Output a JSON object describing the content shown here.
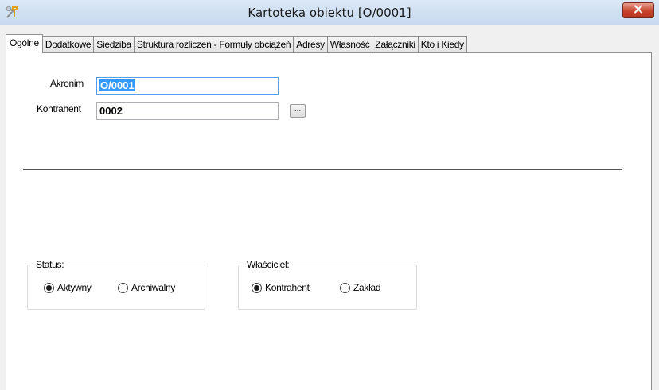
{
  "window": {
    "title": "Kartoteka obiektu [O/0001]"
  },
  "tabs": [
    {
      "label": "Ogólne",
      "active": true
    },
    {
      "label": "Dodatkowe"
    },
    {
      "label": "Siedziba"
    },
    {
      "label": "Struktura rozliczeń - Formuły obciążeń"
    },
    {
      "label": "Adresy"
    },
    {
      "label": "Własność"
    },
    {
      "label": "Załączniki"
    },
    {
      "label": "Kto i Kiedy"
    }
  ],
  "form": {
    "akronim_label": "Akronim",
    "akronim_value": "O/0001",
    "kontrahent_label": "Kontrahent",
    "kontrahent_value": "0002",
    "browse_label": "..."
  },
  "status_group": {
    "legend": "Status:",
    "options": [
      {
        "label": "Aktywny",
        "selected": true
      },
      {
        "label": "Archiwalny",
        "selected": false
      }
    ]
  },
  "owner_group": {
    "legend": "Właściciel:",
    "options": [
      {
        "label": "Kontrahent",
        "selected": true
      },
      {
        "label": "Zakład",
        "selected": false
      }
    ]
  },
  "colors": {
    "accent": "#3399ff",
    "titlebar": "#cfe0f2",
    "close": "#c7432a"
  }
}
